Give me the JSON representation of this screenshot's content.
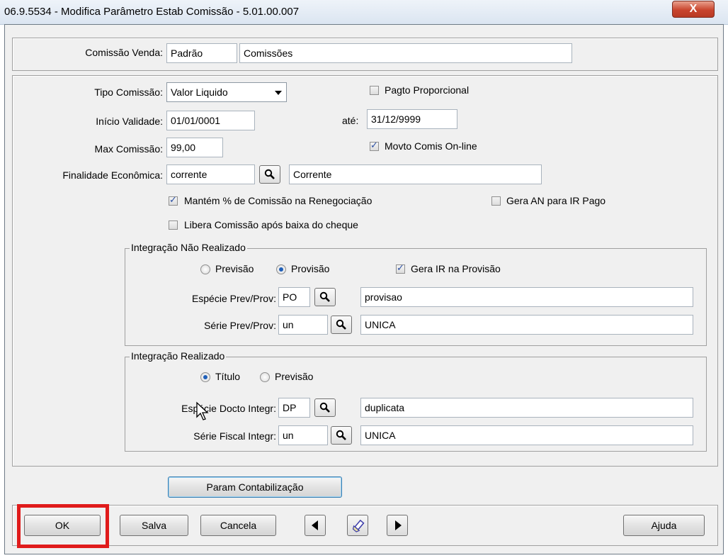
{
  "window": {
    "title": "06.9.5534 - Modifica Parâmetro Estab Comissão - 5.01.00.007",
    "close_label": "X"
  },
  "top_panel": {
    "comissao_label": "Comissão Venda:",
    "comissao_code": "Padrão",
    "comissao_desc": "Comissões"
  },
  "form": {
    "tipo_label": "Tipo Comissão:",
    "tipo_value": "Valor Liquido",
    "pagto_label": "Pagto Proporcional",
    "pagto_checked": false,
    "inicio_label": "Início Validade:",
    "inicio_value": "01/01/0001",
    "ate_label": "até:",
    "ate_value": "31/12/9999",
    "max_label": "Max Comissão:",
    "max_value": "99,00",
    "movto_label": "Movto Comis On-line",
    "movto_checked": true,
    "finalidade_label": "Finalidade Econômica:",
    "finalidade_code": "corrente",
    "finalidade_desc": "Corrente",
    "mantem_label": "Mantém % de Comissão na Renegociação",
    "mantem_checked": true,
    "gera_an_label": "Gera AN para IR Pago",
    "gera_an_checked": false,
    "libera_label": "Libera Comissão após baixa do cheque",
    "libera_checked": false
  },
  "nao_realizado": {
    "legend": "Integração Não Realizado",
    "radio1_label": "Previsão",
    "radio2_label": "Provisão",
    "selected": "Provisão",
    "gera_ir_label": "Gera IR na Provisão",
    "gera_ir_checked": true,
    "especie_label": "Espécie Prev/Prov:",
    "especie_code": "PO",
    "especie_desc": "provisao",
    "serie_label": "Série Prev/Prov:",
    "serie_code": "un",
    "serie_desc": "UNICA"
  },
  "realizado": {
    "legend": "Integração Realizado",
    "radio1_label": "Título",
    "radio2_label": "Previsão",
    "selected": "Título",
    "especie_label": "Espécie Docto Integr:",
    "especie_code": "DP",
    "especie_desc": "duplicata",
    "serie_label": "Série Fiscal Integr:",
    "serie_code": "un",
    "serie_desc": "UNICA"
  },
  "buttons": {
    "param_contab": "Param Contabilização",
    "ok": "OK",
    "salva": "Salva",
    "cancela": "Cancela",
    "ajuda": "Ajuda"
  },
  "icons": {
    "lookup": "magnifier-icon",
    "prev": "prev-arrow-icon",
    "next": "next-arrow-icon",
    "flashlight": "flashlight-icon",
    "close": "close-icon",
    "accent_highlight": "#e01b1b"
  }
}
